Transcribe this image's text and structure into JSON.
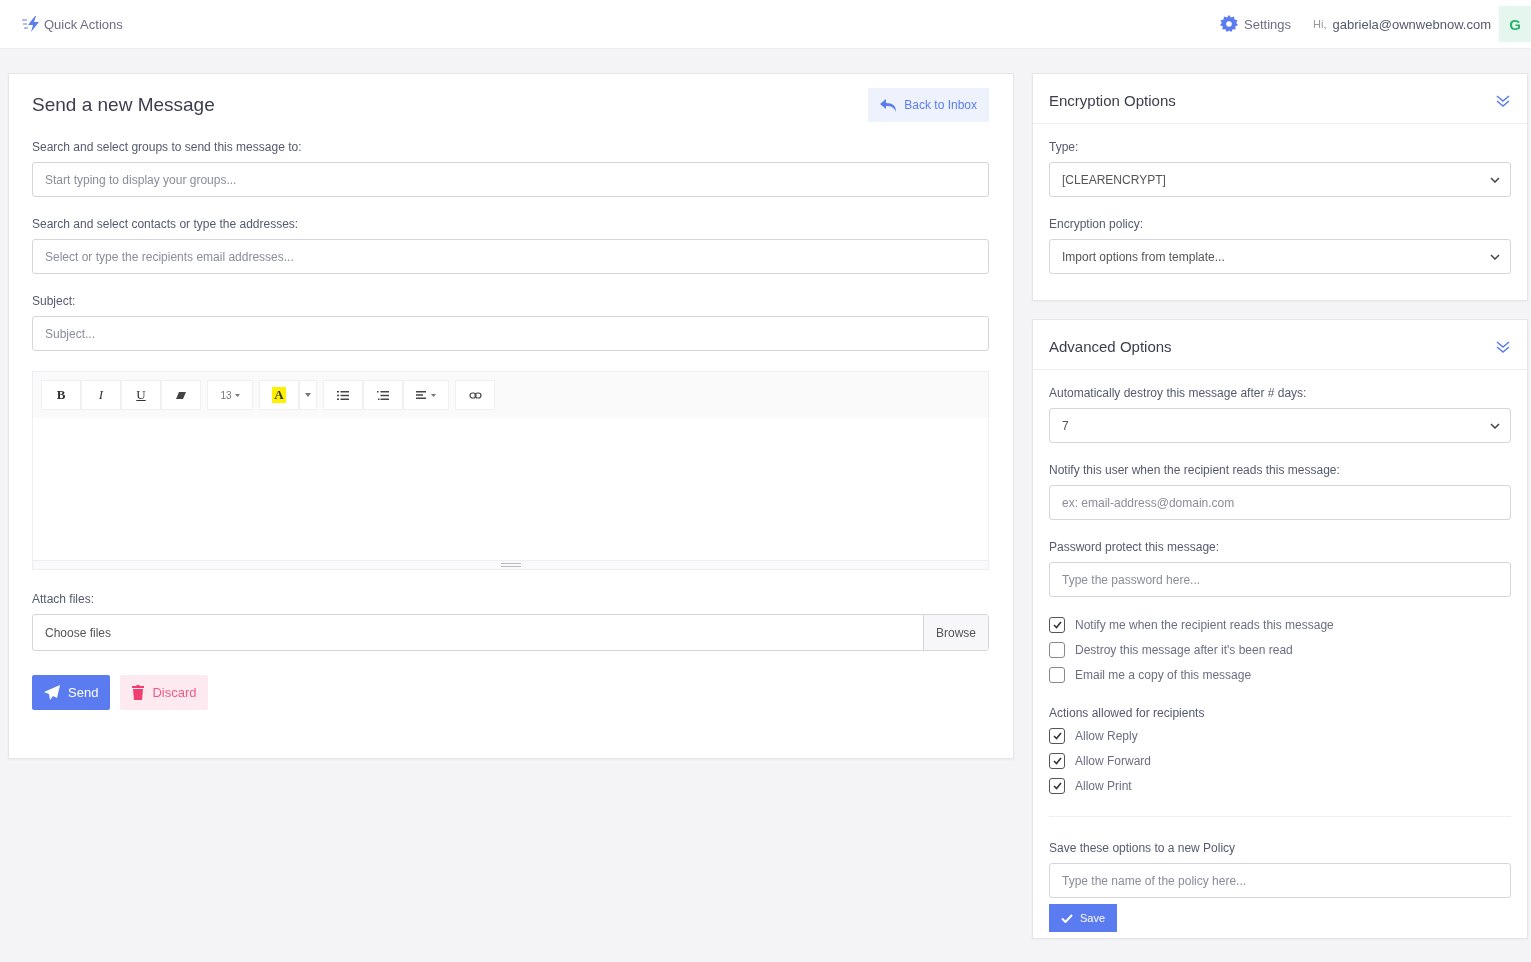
{
  "topbar": {
    "quick_actions": "Quick Actions",
    "settings": "Settings",
    "greeting": "Hi,",
    "user_email": "gabriela@ownwebnow.com",
    "avatar": "G"
  },
  "compose": {
    "title": "Send a new Message",
    "back_button": "Back to Inbox",
    "fields": [
      {
        "label": "Search and select groups to send this message to:",
        "placeholder": "Start typing to display your groups..."
      },
      {
        "label": "Search and select contacts or type the addresses:",
        "placeholder": "Select or type the recipients email addresses..."
      },
      {
        "label": "Subject:",
        "placeholder": "Subject..."
      }
    ],
    "toolbar_groups": [
      [
        {
          "kind": "bold",
          "label": "B"
        },
        {
          "kind": "italic",
          "label": "I"
        },
        {
          "kind": "underline",
          "label": "U"
        },
        {
          "kind": "eraser"
        }
      ],
      [
        {
          "kind": "font-size",
          "label": "13"
        }
      ],
      [
        {
          "kind": "color",
          "label": "A"
        },
        {
          "kind": "caret"
        }
      ],
      [
        {
          "kind": "bullets"
        },
        {
          "kind": "numbers"
        },
        {
          "kind": "align"
        }
      ],
      [
        {
          "kind": "link"
        }
      ]
    ],
    "attach_label": "Attach files:",
    "file_placeholder": "Choose files",
    "browse": "Browse",
    "send": "Send",
    "discard": "Discard"
  },
  "encryption": {
    "title": "Encryption Options",
    "fields": [
      {
        "label": "Type:",
        "value": "[CLEARENCRYPT]"
      },
      {
        "label": "Encryption policy:",
        "value": "Import options from template..."
      }
    ]
  },
  "advanced": {
    "title": "Advanced Options",
    "fields": [
      {
        "kind": "select",
        "label": "Automatically destroy this message after # days:",
        "value": "7"
      },
      {
        "kind": "input",
        "label": "Notify this user when the recipient reads this message:",
        "placeholder": "ex: email-address@domain.com"
      },
      {
        "kind": "input",
        "label": "Password protect this message:",
        "placeholder": "Type the password here..."
      }
    ],
    "options": [
      {
        "label": "Notify me when the recipient reads this message",
        "checked": true
      },
      {
        "label": "Destroy this message after it's been read",
        "checked": false
      },
      {
        "label": "Email me a copy of this message",
        "checked": false
      }
    ],
    "actions_label": "Actions allowed for recipients",
    "actions": [
      {
        "label": "Allow Reply",
        "checked": true
      },
      {
        "label": "Allow Forward",
        "checked": true
      },
      {
        "label": "Allow Print",
        "checked": true
      }
    ],
    "policy_label": "Save these options to a new Policy",
    "policy_placeholder": "Type the name of the policy here...",
    "save": "Save"
  }
}
